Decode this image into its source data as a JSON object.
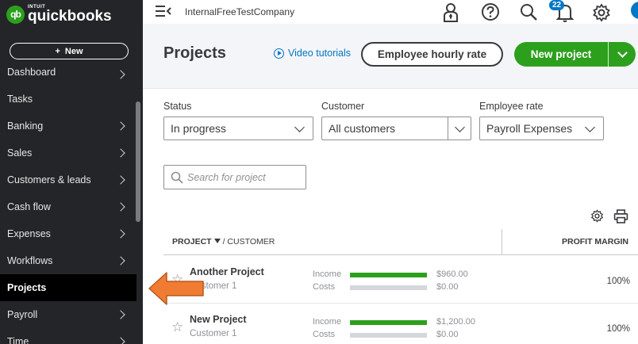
{
  "brand": {
    "intuit": "INTUIT",
    "name": "quickbooks",
    "logo_mark": "qb"
  },
  "sidebar": {
    "new_label": "New",
    "new_icon": "+",
    "items": [
      {
        "label": "Dashboard",
        "chevron": true
      },
      {
        "label": "Tasks",
        "chevron": false
      },
      {
        "label": "Banking",
        "chevron": true
      },
      {
        "label": "Sales",
        "chevron": true
      },
      {
        "label": "Customers & leads",
        "chevron": true
      },
      {
        "label": "Cash flow",
        "chevron": true
      },
      {
        "label": "Expenses",
        "chevron": true
      },
      {
        "label": "Workflows",
        "chevron": true
      },
      {
        "label": "Projects",
        "chevron": false,
        "active": true
      },
      {
        "label": "Payroll",
        "chevron": true
      },
      {
        "label": "Time",
        "chevron": true
      }
    ]
  },
  "topbar": {
    "company": "InternalFreeTestCompany",
    "notification_count": "22"
  },
  "header": {
    "title": "Projects",
    "video_link": "Video tutorials",
    "employee_rate_button": "Employee hourly rate",
    "new_project_button": "New project"
  },
  "filters": {
    "status": {
      "label": "Status",
      "value": "In progress"
    },
    "customer": {
      "label": "Customer",
      "value": "All customers"
    },
    "employee_rate": {
      "label": "Employee rate",
      "value": "Payroll Expenses"
    }
  },
  "search": {
    "placeholder": "Search for project"
  },
  "table": {
    "col_project": "PROJECT",
    "col_customer": "/ CUSTOMER",
    "col_margin": "PROFIT MARGIN",
    "rows": [
      {
        "name": "Another Project",
        "customer": "Customer 1",
        "income_label": "Income",
        "income": "$960.00",
        "costs_label": "Costs",
        "costs": "$0.00",
        "margin": "100%"
      },
      {
        "name": "New Project",
        "customer": "Customer 1",
        "income_label": "Income",
        "income": "$1,200.00",
        "costs_label": "Costs",
        "costs": "$0.00",
        "margin": "100%"
      }
    ]
  },
  "colors": {
    "brand_green": "#2ca01c",
    "sidebar_bg": "#242528",
    "link_blue": "#0077c5",
    "annotation_arrow": "#f07c33"
  }
}
